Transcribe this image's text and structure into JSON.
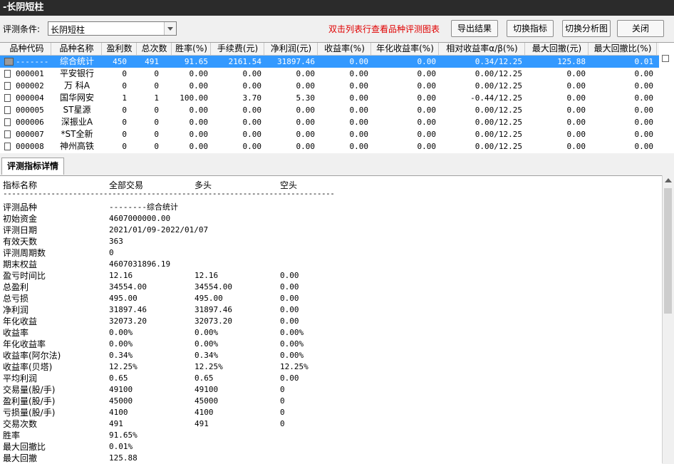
{
  "window": {
    "title": "-长阴短柱"
  },
  "toolbar": {
    "condition_label": "评测条件:",
    "condition_value": "长阴短柱",
    "hint": "双击列表行查看品种评测图表",
    "export_label": "导出结果",
    "switch_metric_label": "切换指标",
    "switch_analysis_label": "切换分析图",
    "close_label": "关闭"
  },
  "table": {
    "headers": [
      "品种代码",
      "品种名称",
      "盈利数",
      "总次数",
      "胜率(%)",
      "手续费(元)",
      "净利润(元)",
      "收益率(%)",
      "年化收益率(%)",
      "相对收益率α/β(%)",
      "最大回撤(元)",
      "最大回撤比(%)"
    ],
    "rows": [
      [
        "-------",
        "综合统计",
        "450",
        "491",
        "91.65",
        "2161.54",
        "31897.46",
        "0.00",
        "0.00",
        "0.34/12.25",
        "125.88",
        "0.01"
      ],
      [
        "000001",
        "平安银行",
        "0",
        "0",
        "0.00",
        "0.00",
        "0.00",
        "0.00",
        "0.00",
        "0.00/12.25",
        "0.00",
        "0.00"
      ],
      [
        "000002",
        "万 科A",
        "0",
        "0",
        "0.00",
        "0.00",
        "0.00",
        "0.00",
        "0.00",
        "0.00/12.25",
        "0.00",
        "0.00"
      ],
      [
        "000004",
        "国华网安",
        "1",
        "1",
        "100.00",
        "3.70",
        "5.30",
        "0.00",
        "0.00",
        "-0.44/12.25",
        "0.00",
        "0.00"
      ],
      [
        "000005",
        "ST星源",
        "0",
        "0",
        "0.00",
        "0.00",
        "0.00",
        "0.00",
        "0.00",
        "0.00/12.25",
        "0.00",
        "0.00"
      ],
      [
        "000006",
        "深振业A",
        "0",
        "0",
        "0.00",
        "0.00",
        "0.00",
        "0.00",
        "0.00",
        "0.00/12.25",
        "0.00",
        "0.00"
      ],
      [
        "000007",
        "*ST全新",
        "0",
        "0",
        "0.00",
        "0.00",
        "0.00",
        "0.00",
        "0.00",
        "0.00/12.25",
        "0.00",
        "0.00"
      ],
      [
        "000008",
        "神州高铁",
        "0",
        "0",
        "0.00",
        "0.00",
        "0.00",
        "0.00",
        "0.00",
        "0.00/12.25",
        "0.00",
        "0.00"
      ]
    ]
  },
  "details": {
    "tab_label": "评测指标详情",
    "headers": [
      "指标名称",
      "全部交易",
      "多头",
      "空头"
    ],
    "separator": "----------------------------------------------------------------------------",
    "rows": [
      [
        "评测品种",
        "--------综合统计",
        "",
        ""
      ],
      [
        "初始资金",
        "4607000000.00",
        "",
        ""
      ],
      [
        "评测日期",
        "2021/01/09-2022/01/07",
        "",
        ""
      ],
      [
        "有效天数",
        "363",
        "",
        ""
      ],
      [
        "评测周期数",
        "0",
        "",
        ""
      ],
      [
        "期末权益",
        "4607031896.19",
        "",
        ""
      ],
      [
        "盈亏时间比",
        "12.16",
        "12.16",
        "0.00"
      ],
      [
        "总盈利",
        "34554.00",
        "34554.00",
        "0.00"
      ],
      [
        "总亏损",
        "495.00",
        "495.00",
        "0.00"
      ],
      [
        "净利润",
        "31897.46",
        "31897.46",
        "0.00"
      ],
      [
        "年化收益",
        "32073.20",
        "32073.20",
        "0.00"
      ],
      [
        "收益率",
        "0.00%",
        "0.00%",
        "0.00%"
      ],
      [
        "年化收益率",
        "0.00%",
        "0.00%",
        "0.00%"
      ],
      [
        "收益率(阿尔法)",
        "0.34%",
        "0.34%",
        "0.00%"
      ],
      [
        "收益率(贝塔)",
        "12.25%",
        "12.25%",
        "12.25%"
      ],
      [
        "平均利润",
        "0.65",
        "0.65",
        "0.00"
      ],
      [
        "交易量(股/手)",
        "49100",
        "49100",
        "0"
      ],
      [
        "盈利量(股/手)",
        "45000",
        "45000",
        "0"
      ],
      [
        "亏损量(股/手)",
        "4100",
        "4100",
        "0"
      ],
      [
        "交易次数",
        "491",
        "491",
        "0"
      ],
      [
        "胜率",
        "91.65%",
        "",
        ""
      ],
      [
        "最大回撤比",
        "0.01%",
        "",
        ""
      ],
      [
        "最大回撤",
        "125.88",
        "",
        ""
      ]
    ]
  }
}
